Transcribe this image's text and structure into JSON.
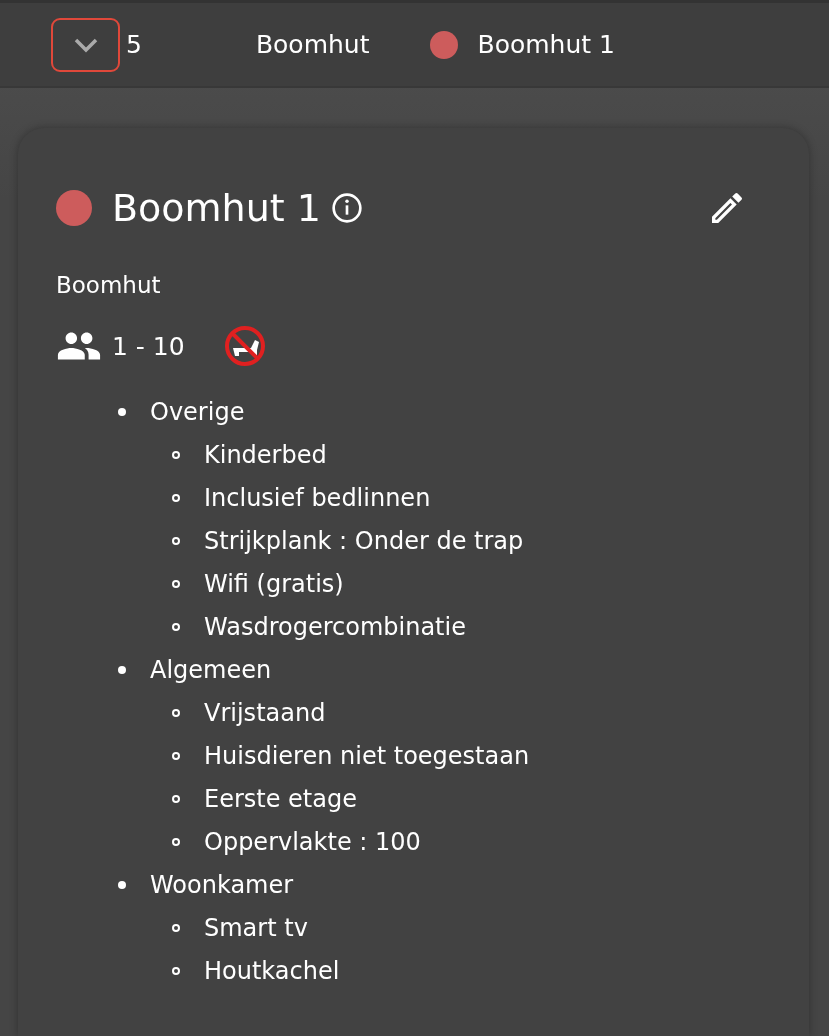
{
  "top_bar": {
    "count": "5",
    "category": "Boomhut",
    "unit": {
      "name": "Boomhut 1",
      "color": "#cd5c5c"
    }
  },
  "card": {
    "title": "Boomhut 1",
    "color": "#cd5c5c",
    "type": "Boomhut",
    "persons": "1 - 10",
    "pets_allowed": false,
    "features": [
      {
        "label": "Overige",
        "children": [
          {
            "label": "Kinderbed"
          },
          {
            "label": "Inclusief bedlinnen"
          },
          {
            "label": "Strijkplank : Onder de trap"
          },
          {
            "label": "Wifi (gratis)"
          },
          {
            "label": "Wasdrogercombinatie"
          }
        ]
      },
      {
        "label": "Algemeen",
        "children": [
          {
            "label": "Vrijstaand"
          },
          {
            "label": "Huisdieren niet toegestaan"
          },
          {
            "label": "Eerste etage"
          },
          {
            "label": "Oppervlakte : 100"
          }
        ]
      },
      {
        "label": "Woonkamer",
        "children": [
          {
            "label": "Smart tv"
          },
          {
            "label": "Houtkachel"
          }
        ]
      }
    ]
  }
}
